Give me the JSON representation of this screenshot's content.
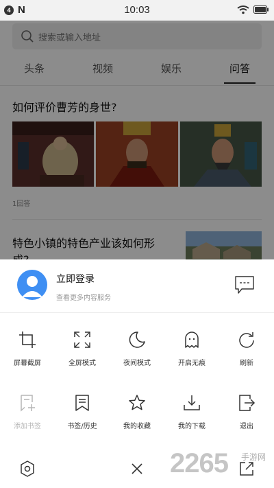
{
  "status_bar": {
    "notification_badge": "4",
    "app_letter": "N",
    "time": "10:03"
  },
  "search": {
    "placeholder": "搜索或输入地址"
  },
  "tabs": [
    "头条",
    "视频",
    "娱乐",
    "问答"
  ],
  "active_tab": "问答",
  "feed": [
    {
      "title": "如何评价曹芳的身世?",
      "meta": "1回答"
    },
    {
      "title": "特色小镇的特色产业该如何形成?"
    }
  ],
  "sheet": {
    "login_title": "立即登录",
    "login_subtitle": "查看更多内容服务",
    "row1": [
      {
        "label": "屏幕截屏",
        "icon": "crop-icon"
      },
      {
        "label": "全屏模式",
        "icon": "fullscreen-icon"
      },
      {
        "label": "夜间模式",
        "icon": "moon-icon"
      },
      {
        "label": "开启无痕",
        "icon": "ghost-icon"
      },
      {
        "label": "刷新",
        "icon": "refresh-icon"
      }
    ],
    "row2": [
      {
        "label": "添加书签",
        "icon": "add-bookmark-icon",
        "disabled": true
      },
      {
        "label": "书签/历史",
        "icon": "bookmark-history-icon"
      },
      {
        "label": "我的收藏",
        "icon": "star-icon"
      },
      {
        "label": "我的下载",
        "icon": "download-icon"
      },
      {
        "label": "退出",
        "icon": "exit-icon"
      }
    ]
  },
  "watermark": {
    "number": "2265",
    "suffix": "手游网"
  },
  "colors": {
    "accent": "#3f8ff3",
    "overlay": "rgba(0,0,0,0.45)"
  }
}
